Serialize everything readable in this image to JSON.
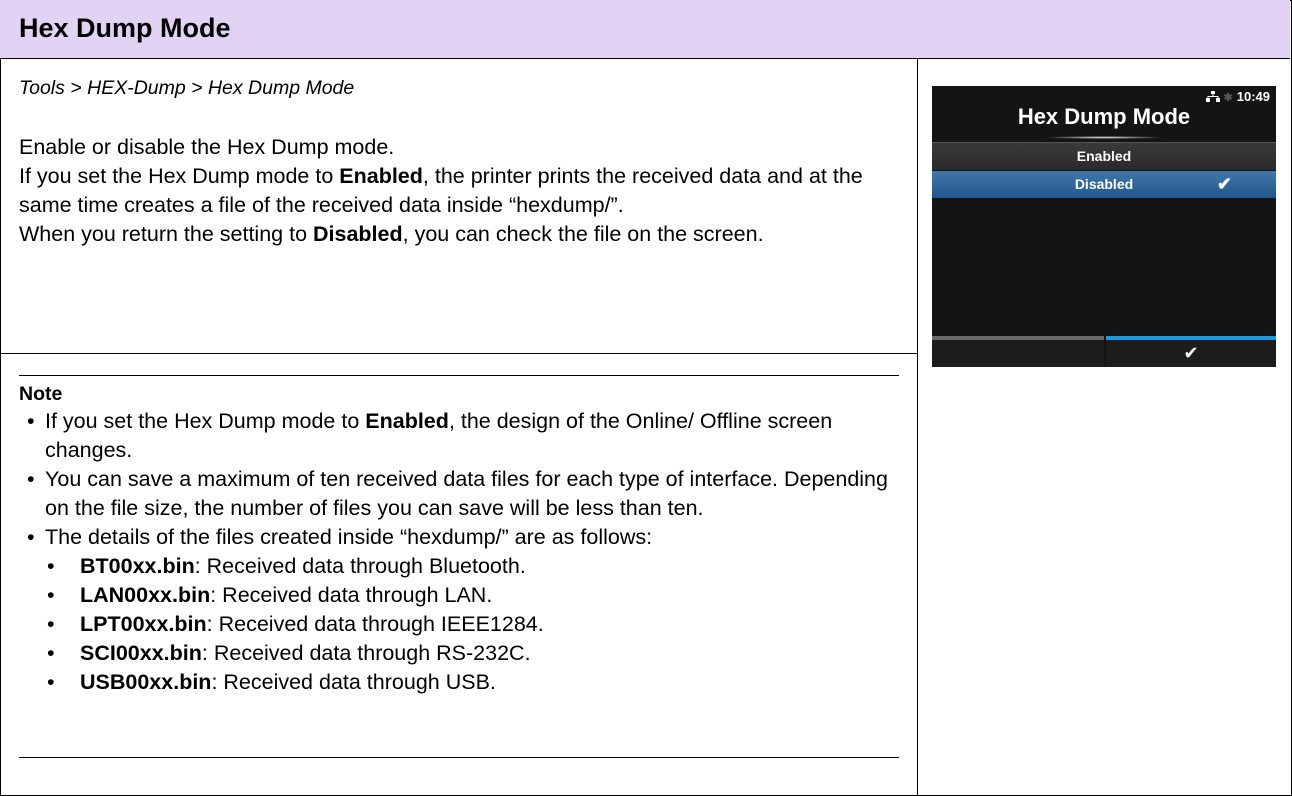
{
  "header": {
    "title": "Hex Dump Mode"
  },
  "breadcrumb": "Tools > HEX-Dump > Hex Dump Mode",
  "description": {
    "line1": "Enable or disable the Hex Dump mode.",
    "p2_pre": "If you set the Hex Dump mode to ",
    "p2_bold": "Enabled",
    "p2_post": ", the printer prints the received data and at the same time creates a file of the received data inside “hexdump/”.",
    "p3_pre": "When you return the setting to ",
    "p3_bold": "Disabled",
    "p3_post": ", you can check the file on the screen."
  },
  "note": {
    "title": "Note",
    "bullet": "•",
    "item1_pre": "If you set the Hex Dump mode to ",
    "item1_bold": "Enabled",
    "item1_post": ", the design of the Online/ Offline screen changes.",
    "item2": "You can save a maximum of ten received data files for each type of interface. Depending on the file size, the number of files you can save will be less than ten.",
    "item3": "The details of the files created inside “hexdump/” are as follows:",
    "files": [
      {
        "name": "BT00xx.bin",
        "desc": ": Received data through Bluetooth."
      },
      {
        "name": "LAN00xx.bin",
        "desc": ": Received data through LAN."
      },
      {
        "name": "LPT00xx.bin",
        "desc": ": Received data through IEEE1284."
      },
      {
        "name": "SCI00xx.bin",
        "desc": ": Received data through RS-232C."
      },
      {
        "name": "USB00xx.bin",
        "desc": ": Received data through USB."
      }
    ]
  },
  "screen": {
    "time": "10:49",
    "title": "Hex Dump Mode",
    "options": [
      "Enabled",
      "Disabled"
    ],
    "selected_option": "Disabled",
    "check_glyph": "✔",
    "icons": [
      "network-icon",
      "bluetooth-icon",
      "check-icon"
    ],
    "colors": {
      "background": "#141414",
      "selected": "#2d6498",
      "accent_bar": "#1a9ae0"
    }
  }
}
